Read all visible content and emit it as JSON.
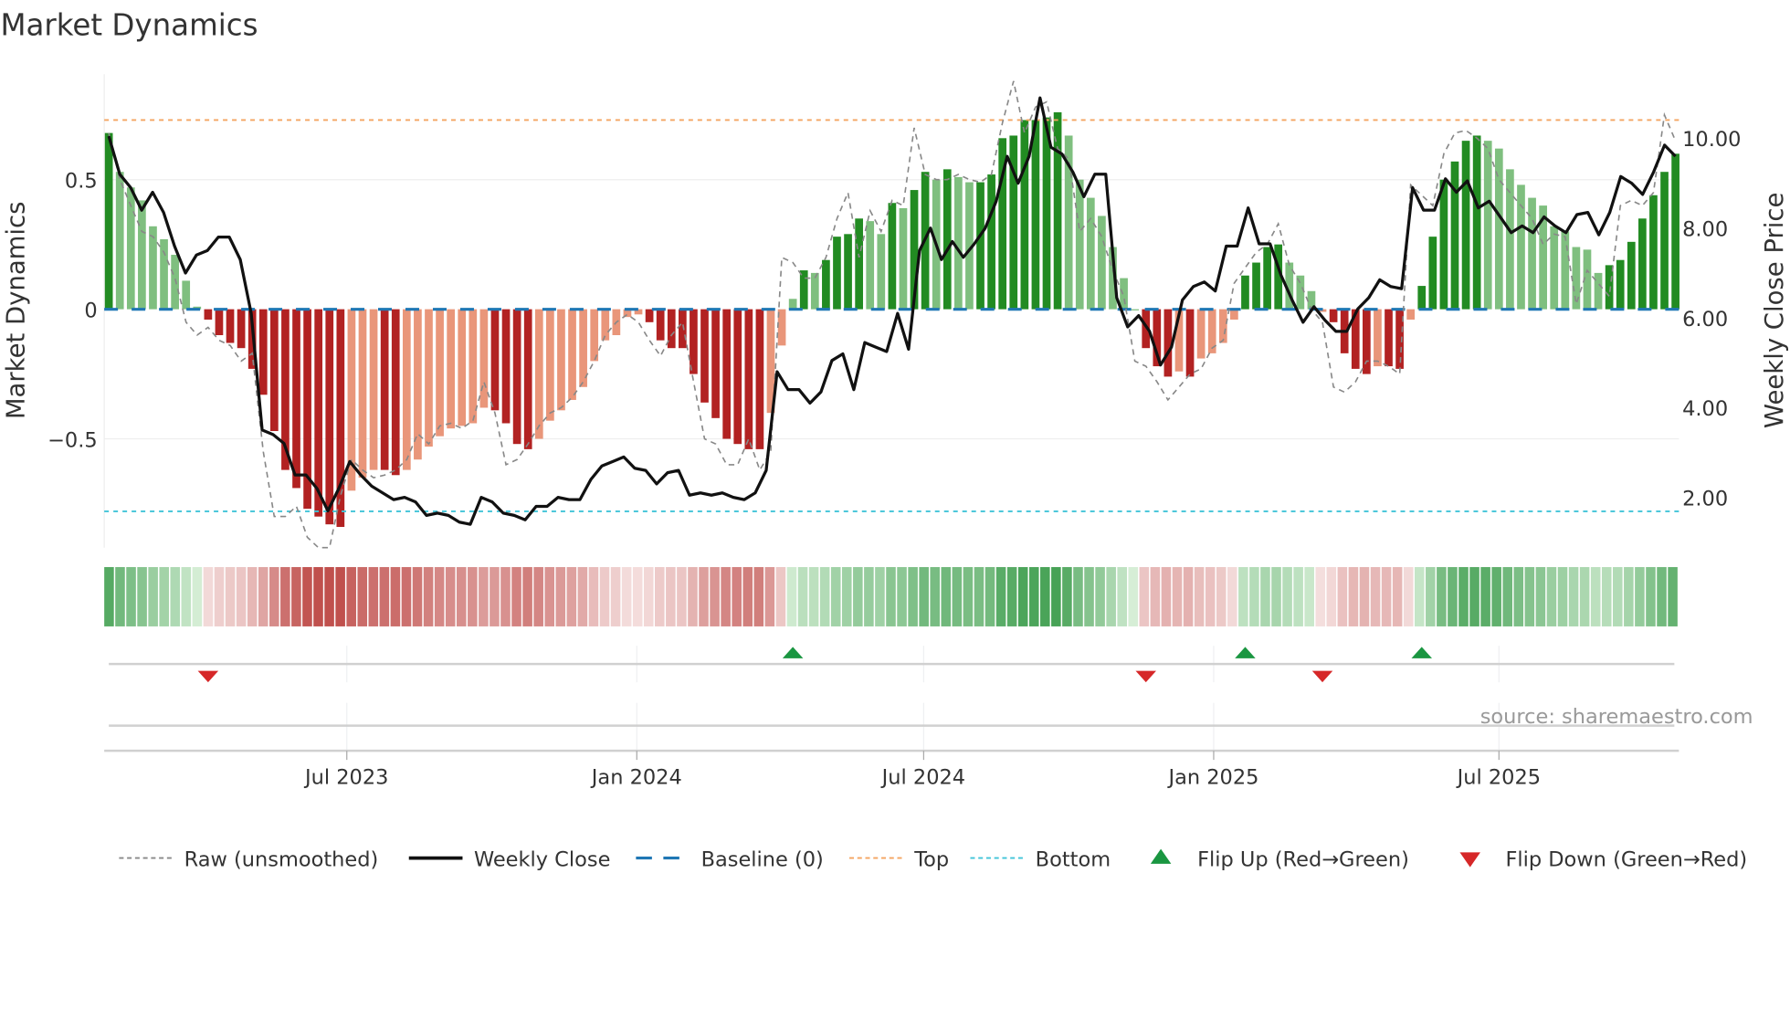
{
  "title": "Market Dynamics",
  "source": "source: sharemaestro.com",
  "colors": {
    "strong_green": "#228b22",
    "weak_green": "#7fbf7f",
    "strong_red": "#b22222",
    "weak_red": "#e9967a",
    "close": "#111111",
    "raw": "#888888",
    "baseline": "#1f77b4",
    "top": "#f4a460",
    "bottom": "#40c4d8",
    "flip_up": "#1a9641",
    "flip_down": "#d62728"
  },
  "chart_data": {
    "type": "bar",
    "title": "Market Dynamics",
    "ylabel": "Market Dynamics",
    "y2label": "Weekly Close Price",
    "ylim": [
      -0.92,
      0.907
    ],
    "y2lim": [
      0.88,
      11.43
    ],
    "yticks": [
      {
        "v": 0.5,
        "label": "0.5"
      },
      {
        "v": 0,
        "label": "0"
      },
      {
        "v": -0.5,
        "label": "−0.5"
      }
    ],
    "y2ticks": [
      {
        "v": 10,
        "label": "10.00"
      },
      {
        "v": 8,
        "label": "8.00"
      },
      {
        "v": 6,
        "label": "6.00"
      },
      {
        "v": 4,
        "label": "4.00"
      },
      {
        "v": 2,
        "label": "2.00"
      }
    ],
    "x_start": "2023-01-31",
    "x_step_days": 7,
    "xticks": [
      {
        "date": "2023-07-01",
        "label": "Jul 2023"
      },
      {
        "date": "2024-01-01",
        "label": "Jan 2024"
      },
      {
        "date": "2024-07-01",
        "label": "Jul 2024"
      },
      {
        "date": "2025-01-01",
        "label": "Jan 2025"
      },
      {
        "date": "2025-07-01",
        "label": "Jul 2025"
      }
    ],
    "top_level": 0.73,
    "bottom_level": -0.78,
    "baseline": 0,
    "dynamics": [
      0.68,
      0.53,
      0.47,
      0.42,
      0.32,
      0.27,
      0.21,
      0.11,
      0.01,
      -0.04,
      -0.1,
      -0.13,
      -0.15,
      -0.23,
      -0.33,
      -0.47,
      -0.62,
      -0.69,
      -0.77,
      -0.8,
      -0.83,
      -0.84,
      -0.7,
      -0.65,
      -0.62,
      -0.62,
      -0.64,
      -0.62,
      -0.58,
      -0.53,
      -0.49,
      -0.46,
      -0.45,
      -0.44,
      -0.38,
      -0.39,
      -0.44,
      -0.52,
      -0.54,
      -0.5,
      -0.43,
      -0.39,
      -0.35,
      -0.3,
      -0.2,
      -0.12,
      -0.1,
      -0.03,
      -0.02,
      -0.05,
      -0.12,
      -0.15,
      -0.15,
      -0.25,
      -0.36,
      -0.42,
      -0.5,
      -0.52,
      -0.54,
      -0.54,
      -0.4,
      -0.14,
      0.04,
      0.15,
      0.14,
      0.19,
      0.28,
      0.29,
      0.35,
      0.34,
      0.29,
      0.41,
      0.39,
      0.46,
      0.53,
      0.5,
      0.54,
      0.51,
      0.49,
      0.49,
      0.52,
      0.66,
      0.67,
      0.73,
      0.73,
      0.74,
      0.76,
      0.67,
      0.5,
      0.43,
      0.36,
      0.24,
      0.12,
      0.0,
      -0.15,
      -0.22,
      -0.26,
      -0.24,
      -0.26,
      -0.19,
      -0.17,
      -0.13,
      -0.04,
      0.13,
      0.18,
      0.24,
      0.25,
      0.18,
      0.13,
      0.07,
      -0.01,
      -0.05,
      -0.17,
      -0.23,
      -0.25,
      -0.22,
      -0.22,
      -0.23,
      -0.04,
      0.09,
      0.28,
      0.5,
      0.57,
      0.65,
      0.67,
      0.65,
      0.62,
      0.54,
      0.48,
      0.43,
      0.4,
      0.32,
      0.3,
      0.24,
      0.23,
      0.14,
      0.17,
      0.19,
      0.26,
      0.35,
      0.44,
      0.53,
      0.6
    ],
    "raw": [
      0.68,
      0.5,
      0.4,
      0.3,
      0.28,
      0.22,
      0.12,
      -0.05,
      -0.1,
      -0.07,
      -0.12,
      -0.14,
      -0.2,
      -0.17,
      -0.55,
      -0.8,
      -0.8,
      -0.76,
      -0.88,
      -0.92,
      -0.92,
      -0.72,
      -0.58,
      -0.62,
      -0.65,
      -0.64,
      -0.62,
      -0.58,
      -0.48,
      -0.52,
      -0.45,
      -0.44,
      -0.46,
      -0.43,
      -0.28,
      -0.4,
      -0.6,
      -0.58,
      -0.52,
      -0.45,
      -0.4,
      -0.38,
      -0.34,
      -0.28,
      -0.2,
      -0.1,
      -0.05,
      -0.02,
      -0.05,
      -0.12,
      -0.18,
      -0.1,
      -0.05,
      -0.28,
      -0.5,
      -0.52,
      -0.6,
      -0.6,
      -0.5,
      -0.62,
      -0.55,
      0.2,
      0.18,
      0.12,
      0.12,
      0.2,
      0.35,
      0.45,
      0.2,
      0.38,
      0.3,
      0.42,
      0.4,
      0.7,
      0.52,
      0.5,
      0.5,
      0.52,
      0.5,
      0.49,
      0.52,
      0.72,
      0.88,
      0.68,
      0.78,
      0.8,
      0.62,
      0.58,
      0.3,
      0.35,
      0.28,
      0.15,
      0.05,
      -0.2,
      -0.22,
      -0.28,
      -0.35,
      -0.3,
      -0.25,
      -0.23,
      -0.15,
      -0.12,
      0.1,
      0.16,
      0.22,
      0.25,
      0.33,
      0.17,
      0.1,
      0.0,
      -0.05,
      -0.3,
      -0.32,
      -0.28,
      -0.2,
      -0.2,
      -0.22,
      -0.25,
      0.48,
      0.44,
      0.4,
      0.6,
      0.68,
      0.69,
      0.66,
      0.62,
      0.5,
      0.45,
      0.4,
      0.35,
      0.25,
      0.29,
      0.28,
      0.02,
      0.15,
      0.1,
      0.05,
      0.4,
      0.42,
      0.4,
      0.45,
      0.75,
      0.65
    ],
    "weekly_close": [
      10.05,
      9.2,
      8.9,
      8.4,
      8.8,
      8.35,
      7.6,
      7.0,
      7.4,
      7.5,
      7.8,
      7.8,
      7.3,
      6.1,
      3.5,
      3.4,
      3.2,
      2.5,
      2.5,
      2.2,
      1.7,
      2.2,
      2.8,
      2.5,
      2.25,
      2.1,
      1.95,
      2.0,
      1.9,
      1.6,
      1.65,
      1.6,
      1.45,
      1.4,
      2.0,
      1.9,
      1.65,
      1.6,
      1.5,
      1.8,
      1.8,
      2.0,
      1.95,
      1.95,
      2.4,
      2.7,
      2.8,
      2.9,
      2.65,
      2.6,
      2.3,
      2.55,
      2.6,
      2.05,
      2.1,
      2.05,
      2.1,
      2.0,
      1.95,
      2.1,
      2.6,
      4.8,
      4.4,
      4.4,
      4.1,
      4.35,
      5.05,
      5.2,
      4.4,
      5.45,
      5.35,
      5.25,
      6.1,
      5.3,
      7.5,
      8.0,
      7.3,
      7.7,
      7.35,
      7.65,
      8.0,
      8.6,
      9.6,
      9.0,
      9.6,
      10.9,
      9.8,
      9.65,
      9.25,
      8.7,
      9.2,
      9.2,
      6.45,
      5.8,
      6.05,
      5.7,
      4.95,
      5.35,
      6.4,
      6.7,
      6.8,
      6.6,
      7.6,
      7.6,
      8.45,
      7.65,
      7.65,
      6.95,
      6.4,
      5.9,
      6.25,
      5.95,
      5.7,
      5.7,
      6.2,
      6.45,
      6.85,
      6.7,
      6.65,
      8.9,
      8.4,
      8.4,
      9.1,
      8.8,
      9.05,
      8.45,
      8.6,
      8.25,
      7.9,
      8.05,
      7.9,
      8.25,
      8.05,
      7.9,
      8.3,
      8.35,
      7.85,
      8.35,
      9.15,
      9.0,
      8.75,
      9.25,
      9.85,
      9.6
    ],
    "legend": {
      "placement": "bottom",
      "raw": "Raw (unsmoothed)",
      "close": "Weekly Close",
      "baseline": "Baseline (0)",
      "top": "Top",
      "bottom": "Bottom",
      "flip_up": "Flip Up (Red→Green)",
      "flip_down": "Flip Down (Green→Red)"
    }
  }
}
